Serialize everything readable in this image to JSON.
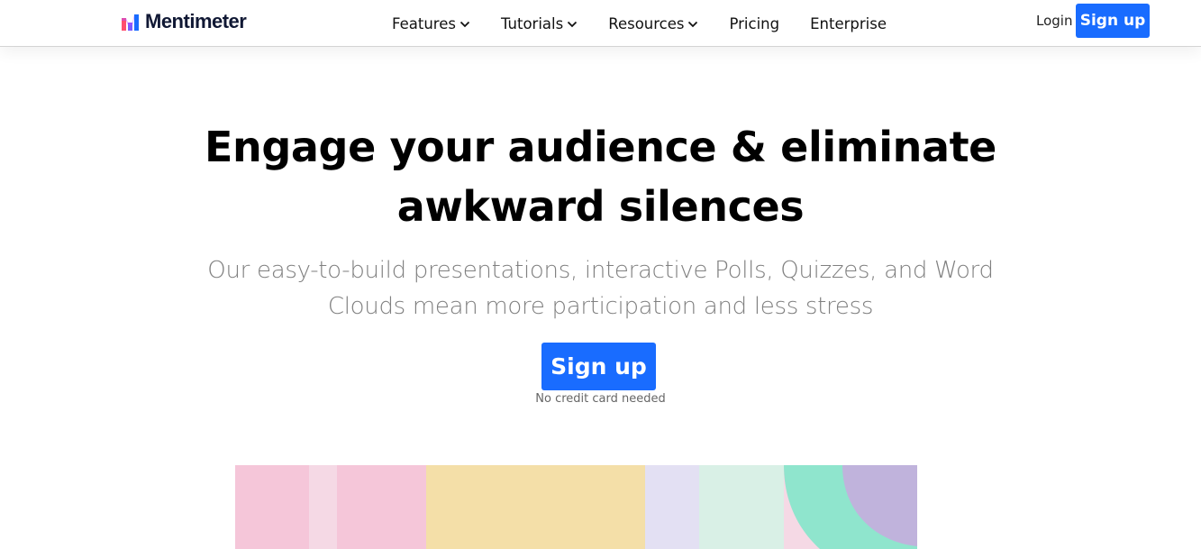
{
  "header": {
    "logo_text": "Mentimeter",
    "logo_icon": "mentimeter-bars-logo",
    "nav": [
      {
        "label": "Features",
        "has_dropdown": true
      },
      {
        "label": "Tutorials",
        "has_dropdown": true
      },
      {
        "label": "Resources",
        "has_dropdown": true
      },
      {
        "label": "Pricing",
        "has_dropdown": false
      },
      {
        "label": "Enterprise",
        "has_dropdown": false
      }
    ],
    "login_label": "Login",
    "signup_label": "Sign up"
  },
  "hero": {
    "title_line1": "Engage your audience & eliminate",
    "title_line2": "awkward silences",
    "subtitle_line1": "Our easy-to-build presentations, interactive Polls, Quizzes, and Word",
    "subtitle_line2": "Clouds mean more participation and less stress",
    "cta_label": "Sign up",
    "cta_note": "No credit card needed"
  },
  "colors": {
    "accent": "#196cff",
    "pink": "#f5c6d9",
    "pink_light": "#f5d9e5",
    "yellow": "#f4dfa8",
    "lavender_light": "#e3e0f3",
    "mint_light": "#d9f0e6",
    "mint": "#8fe5cd",
    "purple": "#c0b3dc"
  }
}
